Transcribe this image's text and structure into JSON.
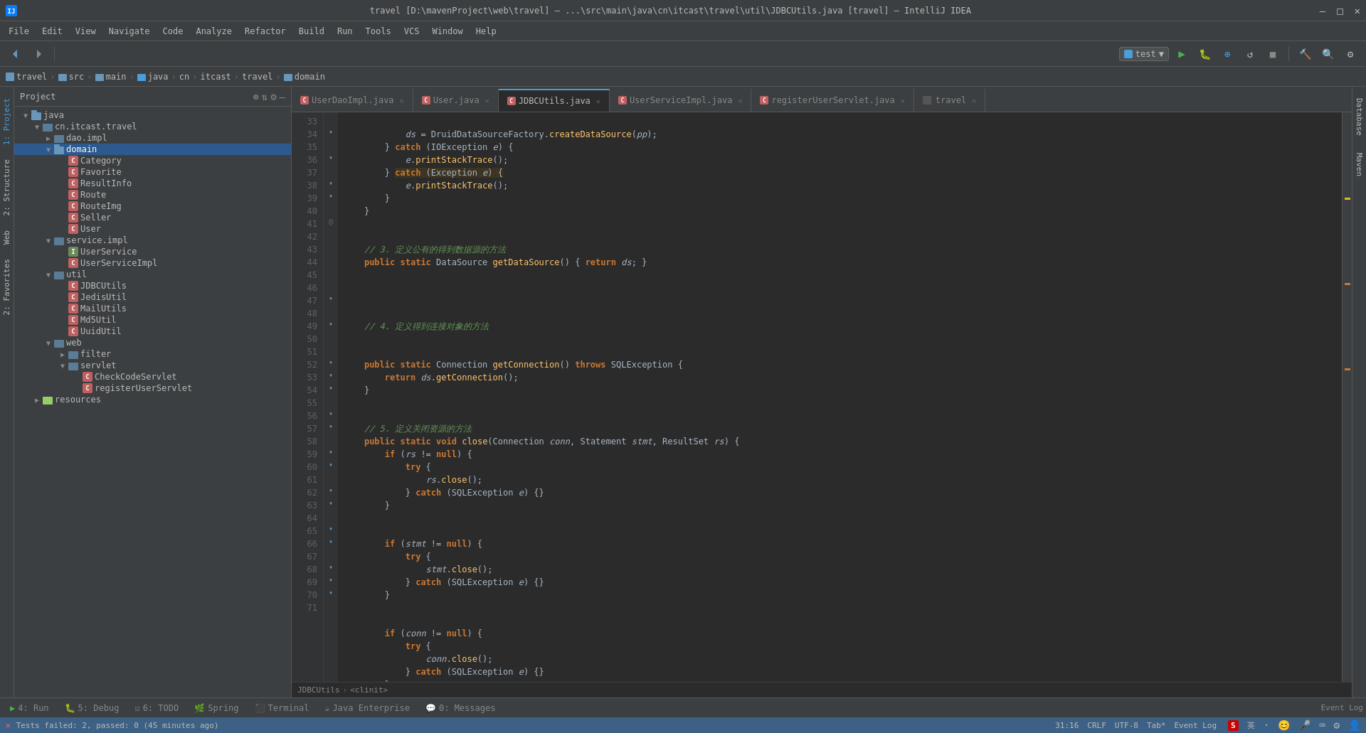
{
  "titleBar": {
    "title": "travel [D:\\mavenProject\\web\\travel] – ...\\src\\main\\java\\cn\\itcast\\travel\\util\\JDBCUtils.java [travel] – IntelliJ IDEA",
    "controls": [
      "—",
      "□",
      "✕"
    ]
  },
  "menuBar": {
    "items": [
      "File",
      "Edit",
      "View",
      "Navigate",
      "Code",
      "Analyze",
      "Refactor",
      "Build",
      "Run",
      "Tools",
      "VCS",
      "Window",
      "Help"
    ]
  },
  "breadcrumb": {
    "items": [
      "travel",
      "src",
      "main",
      "java",
      "cn",
      "itcast",
      "travel",
      "domain"
    ]
  },
  "toolbar": {
    "runConfig": "test"
  },
  "projectPanel": {
    "title": "Project",
    "tree": [
      {
        "id": "java",
        "label": "java",
        "type": "folder",
        "indent": 1,
        "expanded": true
      },
      {
        "id": "cn.itcast.travel",
        "label": "cn.itcast.travel",
        "type": "package",
        "indent": 2,
        "expanded": true
      },
      {
        "id": "dao.impl",
        "label": "dao.impl",
        "type": "folder",
        "indent": 3,
        "expanded": false
      },
      {
        "id": "domain",
        "label": "domain",
        "type": "folder",
        "indent": 3,
        "expanded": true,
        "selected": true
      },
      {
        "id": "Category",
        "label": "Category",
        "type": "class",
        "indent": 4
      },
      {
        "id": "Favorite",
        "label": "Favorite",
        "type": "class",
        "indent": 4
      },
      {
        "id": "ResultInfo",
        "label": "ResultInfo",
        "type": "class",
        "indent": 4
      },
      {
        "id": "Route",
        "label": "Route",
        "type": "class",
        "indent": 4
      },
      {
        "id": "RouteImg",
        "label": "RouteImg",
        "type": "class",
        "indent": 4
      },
      {
        "id": "Seller",
        "label": "Seller",
        "type": "class",
        "indent": 4
      },
      {
        "id": "User",
        "label": "User",
        "type": "class",
        "indent": 4
      },
      {
        "id": "service.impl",
        "label": "service.impl",
        "type": "folder",
        "indent": 3,
        "expanded": true
      },
      {
        "id": "UserService",
        "label": "UserService",
        "type": "interface",
        "indent": 4
      },
      {
        "id": "UserServiceImpl",
        "label": "UserServiceImpl",
        "type": "class",
        "indent": 4
      },
      {
        "id": "util",
        "label": "util",
        "type": "folder",
        "indent": 3,
        "expanded": true
      },
      {
        "id": "JDBCUtils",
        "label": "JDBCUtils",
        "type": "class",
        "indent": 4
      },
      {
        "id": "JedisUtil",
        "label": "JedisUtil",
        "type": "class",
        "indent": 4
      },
      {
        "id": "MailUtils",
        "label": "MailUtils",
        "type": "class",
        "indent": 4
      },
      {
        "id": "Md5Util",
        "label": "Md5Util",
        "type": "class",
        "indent": 4
      },
      {
        "id": "UuidUtil",
        "label": "UuidUtil",
        "type": "class",
        "indent": 4
      },
      {
        "id": "web",
        "label": "web",
        "type": "folder",
        "indent": 3,
        "expanded": true
      },
      {
        "id": "filter",
        "label": "filter",
        "type": "folder",
        "indent": 4,
        "expanded": false
      },
      {
        "id": "servlet",
        "label": "servlet",
        "type": "folder",
        "indent": 4,
        "expanded": true
      },
      {
        "id": "CheckCodeServlet",
        "label": "CheckCodeServlet",
        "type": "class",
        "indent": 5
      },
      {
        "id": "registerUserServlet",
        "label": "registerUserServlet",
        "type": "class",
        "indent": 5
      },
      {
        "id": "resources",
        "label": "resources",
        "type": "folder",
        "indent": 2,
        "expanded": false
      }
    ]
  },
  "tabs": [
    {
      "id": "UserDaoImpl",
      "label": "UserDaoImpl.java",
      "type": "class",
      "active": false,
      "modified": false
    },
    {
      "id": "User",
      "label": "User.java",
      "type": "class",
      "active": false,
      "modified": false
    },
    {
      "id": "JDBCUtils",
      "label": "JDBCUtils.java",
      "type": "class",
      "active": true,
      "modified": false
    },
    {
      "id": "UserServiceImpl",
      "label": "UserServiceImpl.java",
      "type": "class",
      "active": false,
      "modified": false
    },
    {
      "id": "registerUserServlet",
      "label": "registerUserServlet.java",
      "type": "class",
      "active": false,
      "modified": false
    },
    {
      "id": "travel",
      "label": "travel",
      "type": "project",
      "active": false,
      "modified": false
    }
  ],
  "codeLines": [
    {
      "num": 33,
      "content": "            ds = DruidDataSourceFactory.createDataSource(pp);"
    },
    {
      "num": 34,
      "content": "        } catch (IOException e) {"
    },
    {
      "num": 35,
      "content": "            e.printStackTrace();"
    },
    {
      "num": 36,
      "content": "        } catch (Exception e) {"
    },
    {
      "num": 37,
      "content": "            e.printStackTrace();"
    },
    {
      "num": 38,
      "content": "        }"
    },
    {
      "num": 39,
      "content": "    }"
    },
    {
      "num": 40,
      "content": ""
    },
    {
      "num": 41,
      "content": "    // 3. 定义公有的得到数据源的方法"
    },
    {
      "num": 42,
      "content": "    public static DataSource getDataSource() { return ds; }"
    },
    {
      "num": 43,
      "content": ""
    },
    {
      "num": 44,
      "content": ""
    },
    {
      "num": 45,
      "content": "    // 4. 定义得到连接对象的方法"
    },
    {
      "num": 46,
      "content": ""
    },
    {
      "num": 47,
      "content": "    public static Connection getConnection() throws SQLException {"
    },
    {
      "num": 48,
      "content": "        return ds.getConnection();"
    },
    {
      "num": 49,
      "content": "    }"
    },
    {
      "num": 50,
      "content": ""
    },
    {
      "num": 51,
      "content": "    // 5. 定义关闭资源的方法"
    },
    {
      "num": 52,
      "content": "    public static void close(Connection conn, Statement stmt, ResultSet rs) {"
    },
    {
      "num": 53,
      "content": "        if (rs != null) {"
    },
    {
      "num": 54,
      "content": "            try {"
    },
    {
      "num": 55,
      "content": "                rs.close();"
    },
    {
      "num": 56,
      "content": "            } catch (SQLException e) {}"
    },
    {
      "num": 57,
      "content": "        }"
    },
    {
      "num": 58,
      "content": ""
    },
    {
      "num": 59,
      "content": "        if (stmt != null) {"
    },
    {
      "num": 60,
      "content": "            try {"
    },
    {
      "num": 61,
      "content": "                stmt.close();"
    },
    {
      "num": 62,
      "content": "            } catch (SQLException e) {}"
    },
    {
      "num": 63,
      "content": "        }"
    },
    {
      "num": 64,
      "content": ""
    },
    {
      "num": 65,
      "content": "        if (conn != null) {"
    },
    {
      "num": 66,
      "content": "            try {"
    },
    {
      "num": 67,
      "content": "                conn.close();"
    },
    {
      "num": 68,
      "content": "            } catch (SQLException e) {}"
    },
    {
      "num": 69,
      "content": "        }"
    },
    {
      "num": 70,
      "content": "    }"
    },
    {
      "num": 71,
      "content": ""
    }
  ],
  "editorBreadcrumb": {
    "parts": [
      "JDBCUtils",
      "<clinit>"
    ]
  },
  "bottomTabs": [
    {
      "id": "run",
      "label": "4: Run",
      "icon": "▶"
    },
    {
      "id": "debug",
      "label": "5: Debug",
      "icon": "🐛"
    },
    {
      "id": "todo",
      "label": "6: TODO",
      "icon": "☑"
    },
    {
      "id": "spring",
      "label": "Spring",
      "icon": "🌿"
    },
    {
      "id": "terminal",
      "label": "Terminal",
      "icon": "⬛"
    },
    {
      "id": "javaee",
      "label": "Java Enterprise",
      "icon": "☕"
    },
    {
      "id": "messages",
      "label": "0: Messages",
      "icon": "💬"
    }
  ],
  "statusBar": {
    "testResult": "Tests failed: 2, passed: 0 (45 minutes ago)",
    "position": "31:16",
    "lineEnding": "CRLF",
    "encoding": "UTF-8",
    "indent": "Tab*",
    "eventLog": "Event Log"
  },
  "rightSidebar": {
    "tabs": [
      "Database",
      "Maven"
    ]
  }
}
